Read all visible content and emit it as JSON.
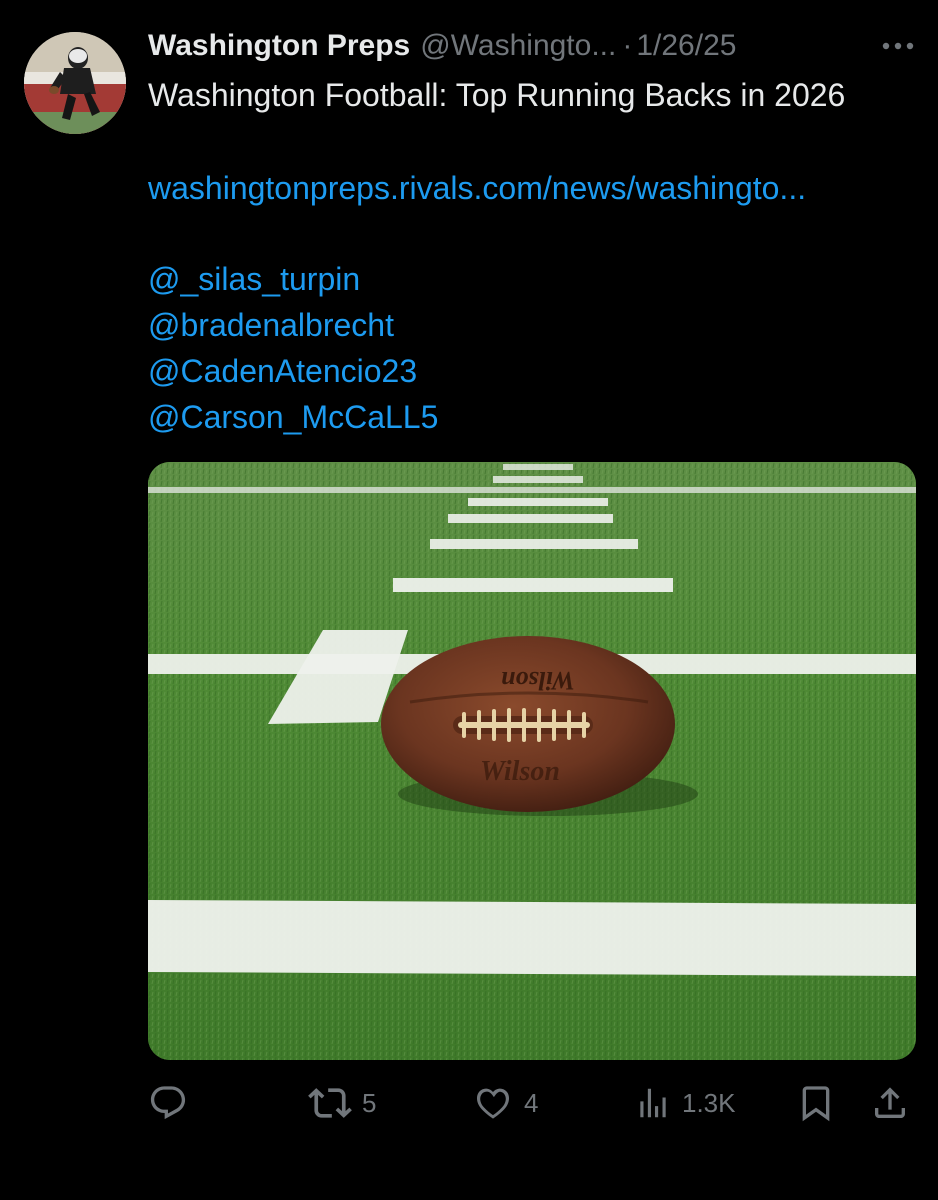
{
  "tweet": {
    "author_name": "Washington Preps",
    "author_handle": "@Washingto...",
    "separator": "·",
    "date": "1/26/25",
    "text": "Washington Football: Top Running Backs in 2026",
    "link": "washingtonpreps.rivals.com/news/washingto...",
    "mentions": [
      "@_silas_turpin",
      "@bradenalbrecht",
      "@CadenAtencio23",
      "@Carson_McCaLL5"
    ],
    "image_text": {
      "ball_brand_top": "Wilson",
      "ball_brand_bottom": "Wilson"
    }
  },
  "actions": {
    "reply_count": "",
    "retweet_count": "5",
    "like_count": "4",
    "views_count": "1.3K"
  },
  "icons": {
    "reply": "reply-icon",
    "retweet": "retweet-icon",
    "like": "heart-icon",
    "views": "views-icon",
    "bookmark": "bookmark-icon",
    "share": "share-icon",
    "more": "more-icon"
  },
  "colors": {
    "background": "#000000",
    "text": "#e7e9ea",
    "muted": "#71767b",
    "link": "#1d9bf0"
  }
}
